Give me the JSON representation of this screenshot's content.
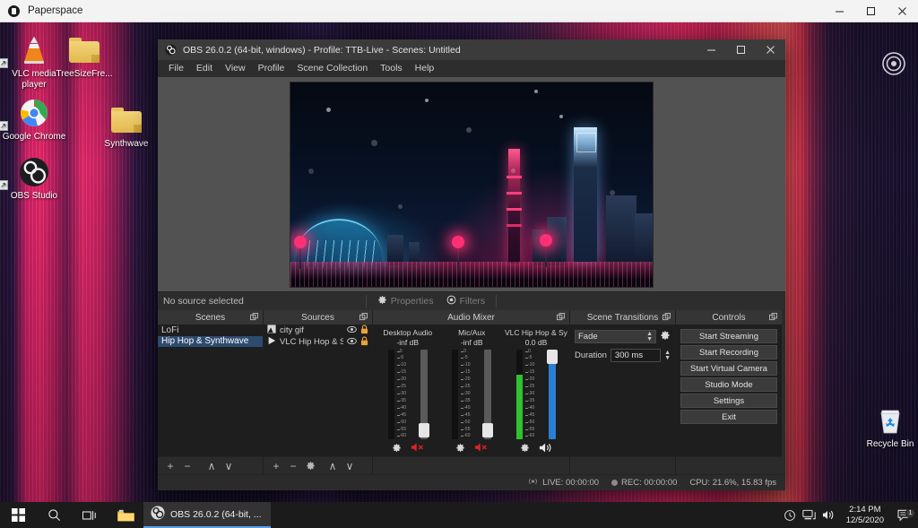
{
  "paperspace": {
    "title": "Paperspace",
    "minimize": "minimize-icon",
    "maximize": "maximize-icon",
    "close": "close-icon"
  },
  "desktop": {
    "icons": [
      {
        "label": "VLC media player",
        "icon": "vlc-cone-icon",
        "shortcut": true
      },
      {
        "label": "TreeSizeFre...",
        "icon": "folder-icon",
        "shortcut": false
      },
      {
        "label": "Google Chrome",
        "icon": "chrome-icon",
        "shortcut": true
      },
      {
        "label": "Synthwave",
        "icon": "folder-icon",
        "shortcut": false
      },
      {
        "label": "OBS Studio",
        "icon": "obs-icon",
        "shortcut": true
      },
      {
        "label": "Recycle Bin",
        "icon": "recycle-bin-icon",
        "shortcut": false
      }
    ],
    "target_widget": "target-icon"
  },
  "obs": {
    "title": "OBS 26.0.2 (64-bit, windows) - Profile: TTB-Live - Scenes: Untitled",
    "menu": [
      "File",
      "Edit",
      "View",
      "Profile",
      "Scene Collection",
      "Tools",
      "Help"
    ],
    "window_buttons": {
      "minimize": "–",
      "maximize": "☐",
      "close": "✕"
    },
    "preview": {
      "alt": "city gif - neon night cityscape"
    },
    "source_bar": {
      "status": "No source selected",
      "properties": "Properties",
      "filters": "Filters"
    },
    "docks": {
      "scenes": {
        "title": "Scenes",
        "items": [
          {
            "label": "LoFi",
            "selected": false
          },
          {
            "label": "Hip Hop & Synthwave",
            "selected": true
          }
        ],
        "toolbar": [
          "+",
          "−",
          "∧",
          "∨"
        ]
      },
      "sources": {
        "title": "Sources",
        "items": [
          {
            "label": "city gif",
            "type_icon": "image-source-icon",
            "visible": true,
            "locked": true
          },
          {
            "label": "VLC Hip Hop & Syn",
            "type_icon": "media-source-icon",
            "visible": true,
            "locked": true
          }
        ],
        "toolbar": [
          "+",
          "−",
          "gear",
          "∧",
          "∨"
        ]
      },
      "mixer": {
        "title": "Audio Mixer",
        "scale_ticks": [
          "0",
          "-5",
          "-10",
          "-15",
          "-20",
          "-25",
          "-30",
          "-35",
          "-40",
          "-45",
          "-50",
          "-55",
          "-60"
        ],
        "channels": [
          {
            "name": "Desktop Audio",
            "db": "-inf dB",
            "level": 0,
            "fader": 8,
            "muted": true,
            "speaker_icon": "speaker-mute-icon"
          },
          {
            "name": "Mic/Aux",
            "db": "-inf dB",
            "level": 0,
            "fader": 8,
            "muted": true,
            "speaker_icon": "speaker-mute-icon"
          },
          {
            "name": "VLC Hip Hop & Synthwa",
            "db": "0.0 dB",
            "level": 72,
            "fader": 92,
            "muted": false,
            "speaker_icon": "speaker-on-icon"
          }
        ]
      },
      "transitions": {
        "title": "Scene Transitions",
        "transition": "Fade",
        "duration_label": "Duration",
        "duration_value": "300 ms",
        "gear": "gear-icon"
      },
      "controls": {
        "title": "Controls",
        "buttons": [
          "Start Streaming",
          "Start Recording",
          "Start Virtual Camera",
          "Studio Mode",
          "Settings",
          "Exit"
        ]
      }
    },
    "status": {
      "live_label": "LIVE: 00:00:00",
      "rec_label": "REC: 00:00:00",
      "cpu": "CPU: 21.6%, 15.83 fps"
    }
  },
  "taskbar": {
    "start": "windows-start-icon",
    "search": "search-icon",
    "taskview": "task-view-icon",
    "explorer": "file-explorer-icon",
    "active_task": "OBS 26.0.2 (64-bit, ...",
    "tray": [
      "cloud-sync-icon",
      "network-icon",
      "volume-icon"
    ],
    "time": "2:14 PM",
    "date": "12/5/2020",
    "notifications": "action-center-icon",
    "notification_count": "1"
  }
}
